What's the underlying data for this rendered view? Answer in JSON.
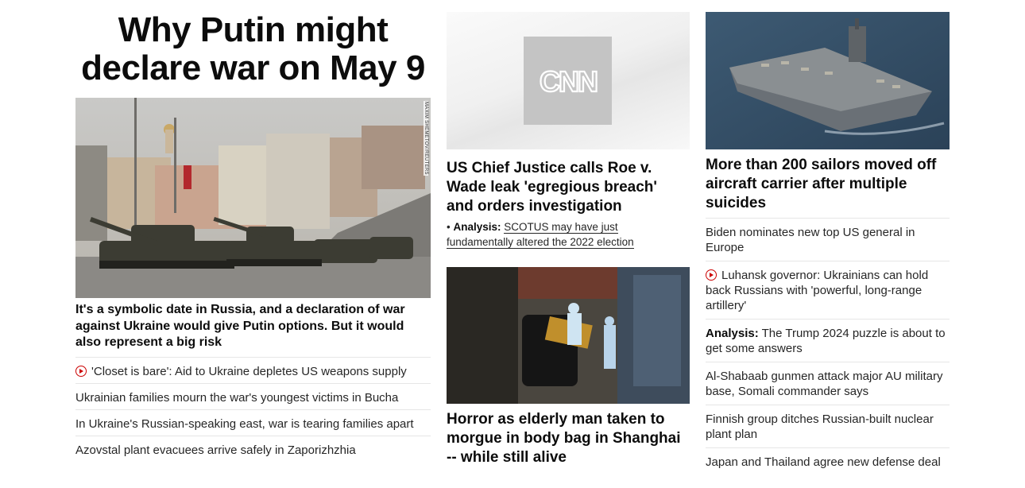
{
  "hero": {
    "headline": "Why Putin might declare war on May 9",
    "image_credit": "MAXIM SHEMETOV/REUTERS",
    "caption": "It's a symbolic date in Russia, and a declaration of war against Ukraine would give Putin options. But it would also represent a big risk"
  },
  "left_list": [
    {
      "text": "'Closet is bare': Aid to Ukraine depletes US weapons supply",
      "video": true
    },
    {
      "text": "Ukrainian families mourn the war's youngest victims in Bucha",
      "video": false
    },
    {
      "text": "In Ukraine's Russian-speaking east, war is tearing families apart",
      "video": false
    },
    {
      "text": "Azovstal plant evacuees arrive safely in Zaporizhzhia",
      "video": false
    }
  ],
  "middle": {
    "logo_text": "CNN",
    "story1_title": "US Chief Justice calls Roe v. Wade leak 'egregious breach' and orders investigation",
    "analysis_bullet": "•",
    "analysis_label": "Analysis:",
    "analysis_text": "SCOTUS may have just fundamentally altered the 2022 election",
    "story2_title": "Horror as elderly man taken to morgue in body bag in Shanghai -- while still alive"
  },
  "right": {
    "story_title": "More than 200 sailors moved off aircraft carrier after multiple suicides",
    "list": [
      {
        "label": "",
        "text": "Biden nominates new top US general in Europe",
        "video": false
      },
      {
        "label": "",
        "text": "Luhansk governor: Ukrainians can hold back Russians with 'powerful, long-range artillery'",
        "video": true
      },
      {
        "label": "Analysis:",
        "text": "The Trump 2024 puzzle is about to get some answers",
        "video": false
      },
      {
        "label": "",
        "text": "Al-Shabaab gunmen attack major AU military base, Somali commander says",
        "video": false
      },
      {
        "label": "",
        "text": "Finnish group ditches Russian-built nuclear plant plan",
        "video": false
      },
      {
        "label": "",
        "text": "Japan and Thailand agree new defense deal",
        "video": false
      }
    ]
  },
  "colors": {
    "video_red": "#cc0000",
    "text": "#262626",
    "divider": "#e6e6e6"
  }
}
